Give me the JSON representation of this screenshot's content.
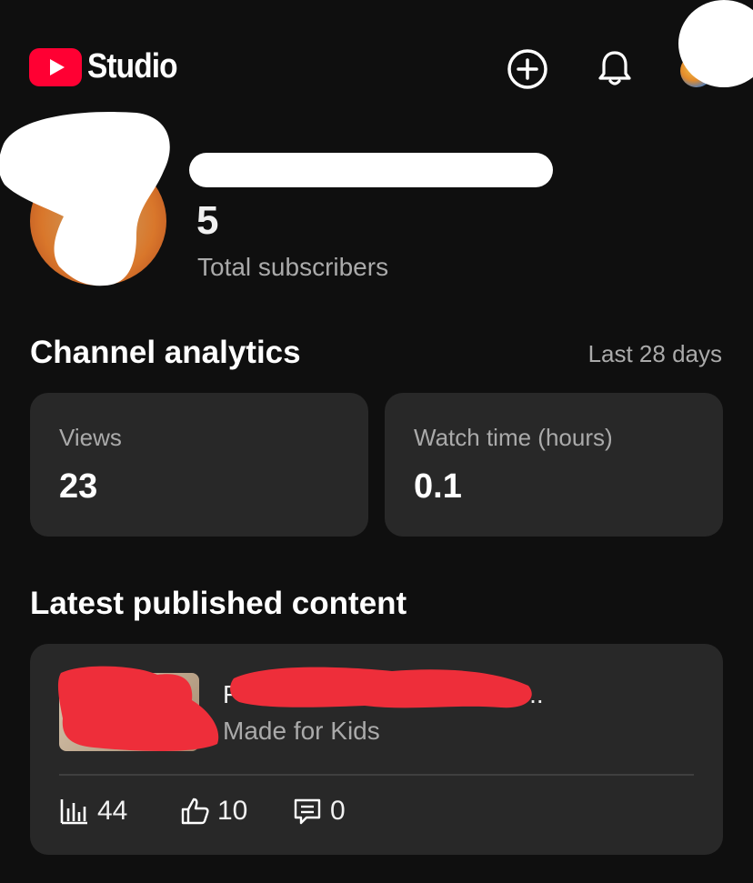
{
  "header": {
    "app_name": "Studio",
    "icons": [
      "youtube-logo-icon",
      "add-icon",
      "bell-icon",
      "avatar"
    ]
  },
  "channel": {
    "subscriber_count": "5",
    "subscriber_label": "Total subscribers"
  },
  "analytics": {
    "title": "Channel analytics",
    "period": "Last 28 days",
    "cards": [
      {
        "label": "Views",
        "value": "23"
      },
      {
        "label": "Watch time (hours)",
        "value": "0.1"
      }
    ]
  },
  "latest": {
    "title": "Latest published content",
    "video": {
      "title_visible": "F",
      "title_suffix": "..",
      "audience": "Made for Kids",
      "stats": {
        "views": "44",
        "likes": "10",
        "comments": "0"
      }
    }
  },
  "colors": {
    "background": "#0f0f0f",
    "card": "#282828",
    "accent": "#ff0033",
    "secondary_text": "#aaaaaa"
  }
}
